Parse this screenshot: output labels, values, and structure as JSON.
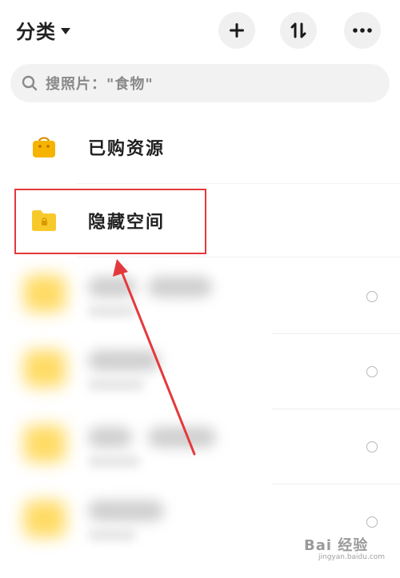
{
  "header": {
    "title": "分类",
    "buttons": [
      {
        "name": "add",
        "icon": "plus-icon"
      },
      {
        "name": "sort",
        "icon": "sort-icon"
      },
      {
        "name": "more",
        "icon": "more-icon"
      }
    ]
  },
  "search": {
    "placeholder": "搜照片：\"食物\"",
    "icon": "search-icon"
  },
  "items": [
    {
      "label": "已购资源",
      "icon": "shopping-bag-icon",
      "color": "#f6b400"
    },
    {
      "label": "隐藏空间",
      "icon": "locked-folder-icon",
      "color": "#f8c92a"
    }
  ],
  "annotation": {
    "highlight_color": "#e4393c",
    "arrow_color": "#e4393c"
  },
  "watermark": {
    "logo": "Bai 经验",
    "sub": "jingyan.baidu.com"
  }
}
